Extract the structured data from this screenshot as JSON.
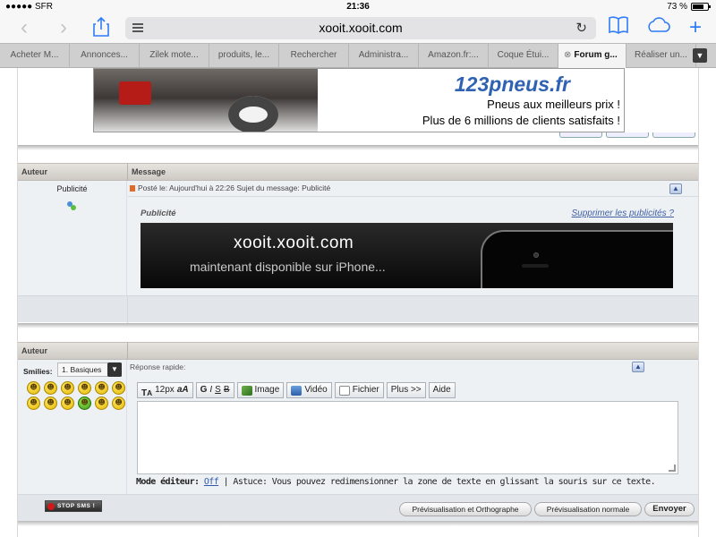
{
  "status_bar": {
    "carrier": "●●●●● SFR",
    "time": "21:36",
    "battery": "73 %",
    "battery_level": 0.73
  },
  "toolbar": {
    "back_icon": "chevron-left-icon",
    "forward_icon": "chevron-right-icon",
    "url": "xooit.xooit.com"
  },
  "tabs": [
    {
      "label": "Acheter M..."
    },
    {
      "label": "Annonces..."
    },
    {
      "label": "Zilek mote..."
    },
    {
      "label": "produits, le..."
    },
    {
      "label": "Rechercher"
    },
    {
      "label": "Administra..."
    },
    {
      "label": "Amazon.fr:..."
    },
    {
      "label": "Coque Étui..."
    },
    {
      "label": "Forum g..."
    },
    {
      "label": "Réaliser un..."
    }
  ],
  "ad_banner": {
    "brand": "123pneus.fr",
    "line1": "Pneus aux meilleurs prix !",
    "line2": "Plus de 6 millions de clients satisfaits !"
  },
  "post_table": {
    "col_author": "Auteur",
    "col_message": "Message",
    "author": "Publicité",
    "meta": "Posté le: Aujourd'hui à 22:26    Sujet du message: Publicité",
    "ad_title": "Publicité",
    "remove_ads": "Supprimer les publicités ?",
    "banner_line1": "xooit.xooit.com",
    "banner_line2": "maintenant disponible sur iPhone..."
  },
  "reply": {
    "col_author": "Auteur",
    "smilies_label": "Smilies:",
    "smilies_set": "1. Basiques",
    "label": "Réponse rapide:",
    "toolbar": {
      "font_size": "12px",
      "bold": "G",
      "italic": "I",
      "underline": "S",
      "strike": "B",
      "image": "Image",
      "video": "Vidéo",
      "file": "Fichier",
      "more": "Plus >>",
      "help": "Aide"
    },
    "mode_label": "Mode éditeur:",
    "mode_value": "Off",
    "tip": " | Astuce: Vous pouvez redimensionner la zone de texte en glissant la souris sur ce texte.",
    "stop_badge": "STOP SMS !",
    "btn_preview_spell": "Prévisualisation et Orthographe",
    "btn_preview": "Prévisualisation normale",
    "btn_send": "Envoyer"
  }
}
